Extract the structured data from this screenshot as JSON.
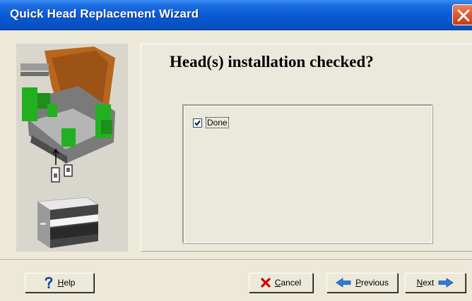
{
  "window": {
    "title": "Quick Head Replacement Wizard"
  },
  "main": {
    "heading": "Head(s) installation checked?",
    "checkbox": {
      "label": "Done",
      "checked": true
    }
  },
  "buttons": {
    "help": {
      "mnemonic": "H",
      "rest": "elp",
      "icon": "question-icon"
    },
    "cancel": {
      "mnemonic": "C",
      "rest": "ancel",
      "icon": "red-x-icon"
    },
    "previous": {
      "mnemonic": "P",
      "rest": "revious",
      "icon": "left-arrow-icon"
    },
    "next": {
      "mnemonic": "N",
      "rest": "ext",
      "icon": "right-arrow-icon"
    }
  },
  "colors": {
    "titlebar": "#0a5bd6",
    "close": "#e35a30",
    "dialog_bg": "#ece9d8",
    "arrow": "#2a7de0",
    "cancel_x": "#cc0000",
    "help_q": "#1144aa"
  }
}
